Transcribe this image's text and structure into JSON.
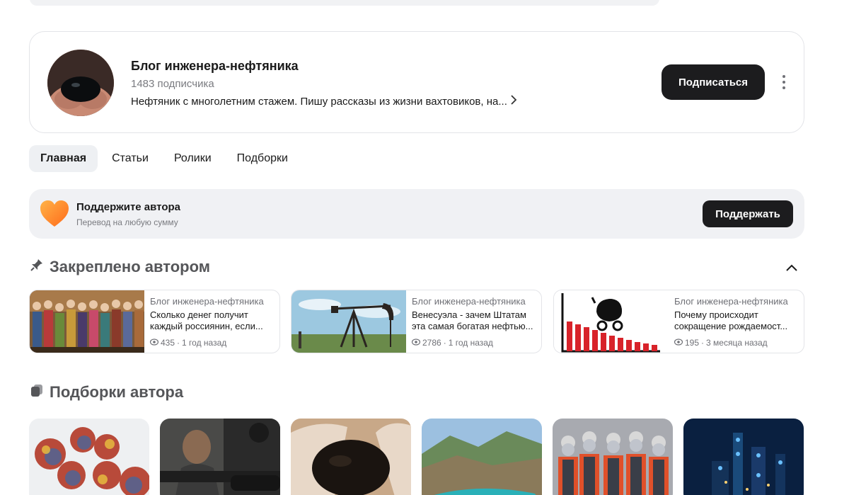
{
  "channel": {
    "title": "Блог инженера-нефтяника",
    "subscribers": "1483 подписчика",
    "description": "Нефтяник с многолетним стажем. Пишу рассказы из жизни вахтовиков, на...",
    "subscribe_label": "Подписаться"
  },
  "tabs": [
    {
      "label": "Главная"
    },
    {
      "label": "Статьи"
    },
    {
      "label": "Ролики"
    },
    {
      "label": "Подборки"
    }
  ],
  "support": {
    "title": "Поддержите автора",
    "subtitle": "Перевод на любую сумму",
    "button_label": "Поддержать"
  },
  "pinned": {
    "heading": "Закреплено автором",
    "items": [
      {
        "source": "Блог инженера-нефтяника",
        "title_line1": "Сколько денег получит",
        "title_line2": "каждый россиянин, если...",
        "views": "435",
        "age": "1 год назад"
      },
      {
        "source": "Блог инженера-нефтяника",
        "title_line1": "Венесуэла - зачем Штатам",
        "title_line2": "эта самая богатая нефтью...",
        "views": "2786",
        "age": "1 год назад"
      },
      {
        "source": "Блог инженера-нефтяника",
        "title_line1": "Почему происходит",
        "title_line2": "сокращение рождаемост...",
        "views": "195",
        "age": "3 месяца назад"
      }
    ]
  },
  "collections": {
    "heading": "Подборки автора"
  },
  "colors": {
    "accent_dark": "#1c1c1e",
    "heart_orange": "#ff8a2a",
    "chart_red": "#d8232a"
  }
}
